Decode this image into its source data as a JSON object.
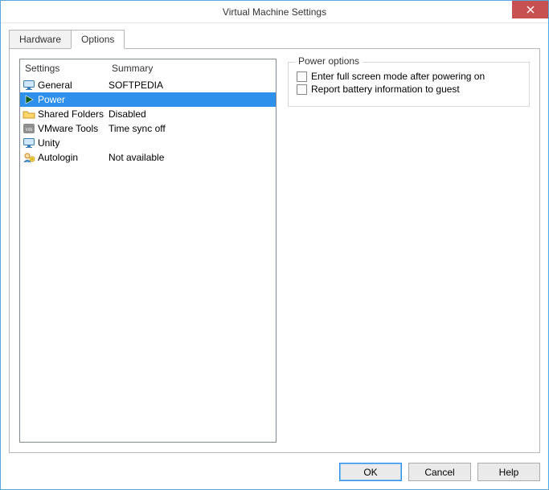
{
  "window": {
    "title": "Virtual Machine Settings"
  },
  "tabs": {
    "hardware": "Hardware",
    "options": "Options",
    "active": "options"
  },
  "list": {
    "headers": {
      "settings": "Settings",
      "summary": "Summary"
    },
    "rows": [
      {
        "icon": "monitor",
        "name": "General",
        "summary": "SOFTPEDIA",
        "selected": false
      },
      {
        "icon": "play",
        "name": "Power",
        "summary": "",
        "selected": true
      },
      {
        "icon": "folder",
        "name": "Shared Folders",
        "summary": "Disabled",
        "selected": false
      },
      {
        "icon": "vmw",
        "name": "VMware Tools",
        "summary": "Time sync off",
        "selected": false
      },
      {
        "icon": "monitor",
        "name": "Unity",
        "summary": "",
        "selected": false
      },
      {
        "icon": "autologin",
        "name": "Autologin",
        "summary": "Not available",
        "selected": false
      }
    ]
  },
  "group": {
    "title": "Power options",
    "opt1": "Enter full screen mode after powering on",
    "opt2": "Report battery information to guest"
  },
  "buttons": {
    "ok": "OK",
    "cancel": "Cancel",
    "help": "Help"
  }
}
